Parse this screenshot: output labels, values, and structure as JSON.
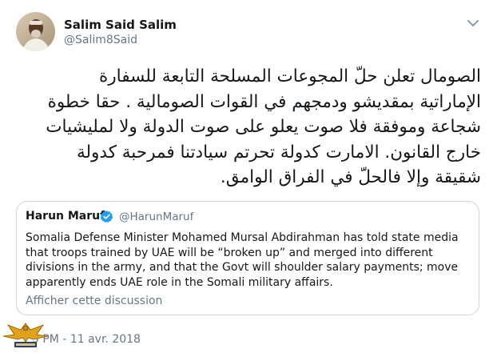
{
  "tweet": {
    "author": {
      "display_name": "Salim Said Salim",
      "handle": "@Salim8Said"
    },
    "text": "الصومال تعلن حلّ  المجوعات المسلحة التابعة للسفارة\nالإماراتية بمقديشو ودمجهم في القوات الصومالية . حقا خطوة\nشجاعة وموفقة فلا صوت يعلو على صوت الدولة ولا لمليشيات\nخارج القانون. الامارت كدولة تحرتم سيادتنا فمرحبة كدولة\nشقيقة وإلا  فالحلّ في الفراق الوامق.",
    "timestamp": "5 PM - 11 avr. 2018"
  },
  "quoted_tweet": {
    "author": {
      "display_name": "Harun Maruf",
      "handle": "@HarunMaruf",
      "verified": true
    },
    "text": "Somalia Defense Minister Mohamed Mursal Abdirahman has told state media that troops trained by UAE will be “broken up” and merged into different divisions in the army, and that the Govt will shoulder salary payments; move apparently ends UAE role in the Somali military affairs.",
    "show_discussion_label": "Afficher cette discussion"
  },
  "icons": {
    "menu": "chevron-down-icon",
    "verified": "verified-badge-icon",
    "watermark": "eagle-watermark-logo"
  },
  "colors": {
    "text": "#14171a",
    "secondary": "#657786",
    "border": "#ccd6dd",
    "verified": "#1da1f2"
  }
}
